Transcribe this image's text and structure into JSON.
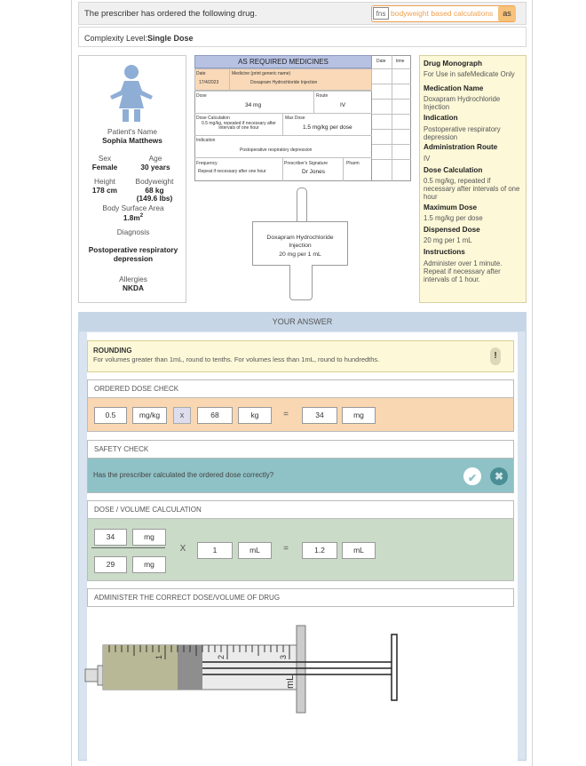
{
  "header": {
    "instruction": "The prescriber has ordered the following drug.",
    "badge_fns": "fns",
    "badge_text": "bodyweight based calculations",
    "badge_as": "as",
    "complexity_label": "Complexity Level:",
    "complexity_value": "Single Dose"
  },
  "patient": {
    "name_label": "Patient's Name",
    "name": "Sophia Matthews",
    "sex_label": "Sex",
    "sex": "Female",
    "age_label": "Age",
    "age": "30 years",
    "height_label": "Height",
    "height": "178 cm",
    "weight_label": "Bodyweight",
    "weight": "68 kg",
    "weight_lbs": "(149.6 lbs)",
    "bsa_label": "Body Surface Area",
    "bsa": "1.8m",
    "bsa_sup": "2",
    "diagnosis_label": "Diagnosis",
    "diagnosis": "Postoperative respiratory depression",
    "allergies_label": "Allergies",
    "allergies": "NKDA"
  },
  "med_chart": {
    "title": "AS REQUIRED MEDICINES",
    "date_label": "Date",
    "date": "17/4/2023",
    "medicine_label": "Medicine (print generic name)",
    "medicine": "Doxapram Hydrochloride Injection",
    "dose_label": "Dose",
    "dose": "34 mg",
    "route_label": "Route",
    "route": "IV",
    "calc_label": "Dose Calculation",
    "calc": "0.5 mg/kg, repeated if necessary after intervals of one hour",
    "maxdose_label": "Max Dose",
    "maxdose": "1.5 mg/kg per dose",
    "indication_label": "Indication",
    "indication": "Postoperative respiratory depression",
    "frequency_label": "Frequency",
    "frequency": "Repeat if necessary after one hour",
    "sig_label": "Prescriber's Signature",
    "sig": "Dr Jones",
    "pharm_label": "Pharm",
    "col_date": "Date",
    "col_time": "time"
  },
  "ampoule": {
    "line1": "Doxapram Hydrochloride",
    "line2": "Injection",
    "line3": "20 mg per 1 mL"
  },
  "monograph": {
    "title": "Drug Monograph",
    "subtitle": "For Use in safeMedicate Only",
    "name_h": "Medication Name",
    "name_v": "Doxapram Hydrochloride Injection",
    "indication_h": "Indication",
    "indication_v": "Postoperative respiratory depression",
    "route_h": "Administration Route",
    "route_v": "IV",
    "calc_h": "Dose Calculation",
    "calc_v": "0.5 mg/kg, repeated if necessary after intervals of one hour",
    "max_h": "Maximum Dose",
    "max_v": "1.5 mg/kg per dose",
    "disp_h": "Dispensed Dose",
    "disp_v": "20 mg per 1 mL",
    "instr_h": "Instructions",
    "instr_v": "Administer over 1 minute. Repeat if necessary after intervals of 1 hour."
  },
  "answer": {
    "title": "YOUR ANSWER",
    "rounding_title": "ROUNDING",
    "rounding_text": "For volumes greater than 1mL, round to tenths. For volumes less than 1mL, round to hundredths.",
    "rounding_icon": "!",
    "ordered_label": "ORDERED DOSE CHECK",
    "ordered": {
      "dose": "0.5",
      "dose_unit": "mg/kg",
      "times": "x",
      "weight": "68",
      "weight_unit": "kg",
      "equals": "=",
      "result": "34",
      "result_unit": "mg"
    },
    "safety_label": "SAFETY CHECK",
    "safety_question": "Has the prescriber calculated the ordered dose correctly?",
    "yes_icon": "✔",
    "no_icon": "✖",
    "dv_label": "DOSE / VOLUME CALCULATION",
    "dv": {
      "num": "34",
      "num_unit": "mg",
      "den": "29",
      "den_unit": "mg",
      "times": "X",
      "vol": "1",
      "vol_unit": "mL",
      "equals": "=",
      "result": "1.2",
      "result_unit": "mL"
    },
    "administer_label": "ADMINISTER THE CORRECT DOSE/VOLUME OF DRUG"
  },
  "syringe": {
    "unit": "mL",
    "filled_ml": 1.2,
    "max_ml": 3,
    "tick_labels": [
      "1",
      "2",
      "3"
    ]
  },
  "colors": {
    "chart_header": "#b7c2e3",
    "chart_row": "#fad9b8",
    "monograph_bg": "#fcf8d8",
    "ordered_bg": "#f9d7b2",
    "safety_bg": "#8fc2c6",
    "dv_bg": "#cadcc8",
    "yes": "#4a9e9e",
    "no": "#4a9e9e"
  }
}
